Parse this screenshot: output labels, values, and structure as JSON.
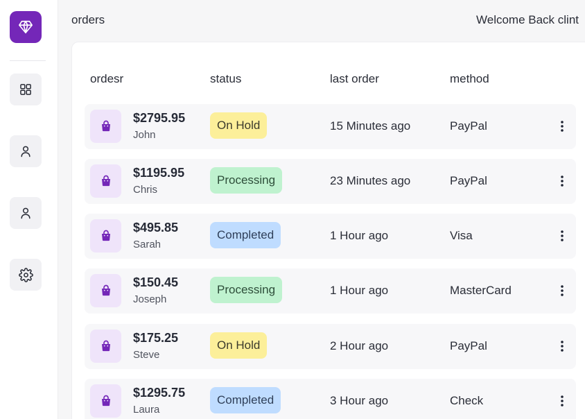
{
  "header": {
    "title": "orders",
    "welcome": "Welcome Back clint"
  },
  "sidebar": {
    "logo_icon": "diamond-icon",
    "items": [
      {
        "icon": "grid-icon"
      },
      {
        "icon": "user-icon"
      },
      {
        "icon": "user-icon"
      },
      {
        "icon": "gear-icon"
      }
    ]
  },
  "table": {
    "columns": [
      "ordesr",
      "status",
      "last order",
      "method"
    ],
    "rows": [
      {
        "amount": "$2795.95",
        "customer": "John",
        "status": "On Hold",
        "last_order": "15 Minutes ago",
        "method": "PayPal"
      },
      {
        "amount": "$1195.95",
        "customer": "Chris",
        "status": "Processing",
        "last_order": "23 Minutes ago",
        "method": "PayPal"
      },
      {
        "amount": "$495.85",
        "customer": "Sarah",
        "status": "Completed",
        "last_order": "1 Hour ago",
        "method": "Visa"
      },
      {
        "amount": "$150.45",
        "customer": "Joseph",
        "status": "Processing",
        "last_order": "1 Hour ago",
        "method": "MasterCard"
      },
      {
        "amount": "$175.25",
        "customer": "Steve",
        "status": "On Hold",
        "last_order": "2 Hour ago",
        "method": "PayPal"
      },
      {
        "amount": "$1295.75",
        "customer": "Laura",
        "status": "Completed",
        "last_order": "3 Hour ago",
        "method": "Check"
      }
    ]
  },
  "colors": {
    "accent": "#7427b8",
    "on_hold": "#fcef9a",
    "processing": "#bff2cf",
    "completed": "#bfdcff"
  }
}
